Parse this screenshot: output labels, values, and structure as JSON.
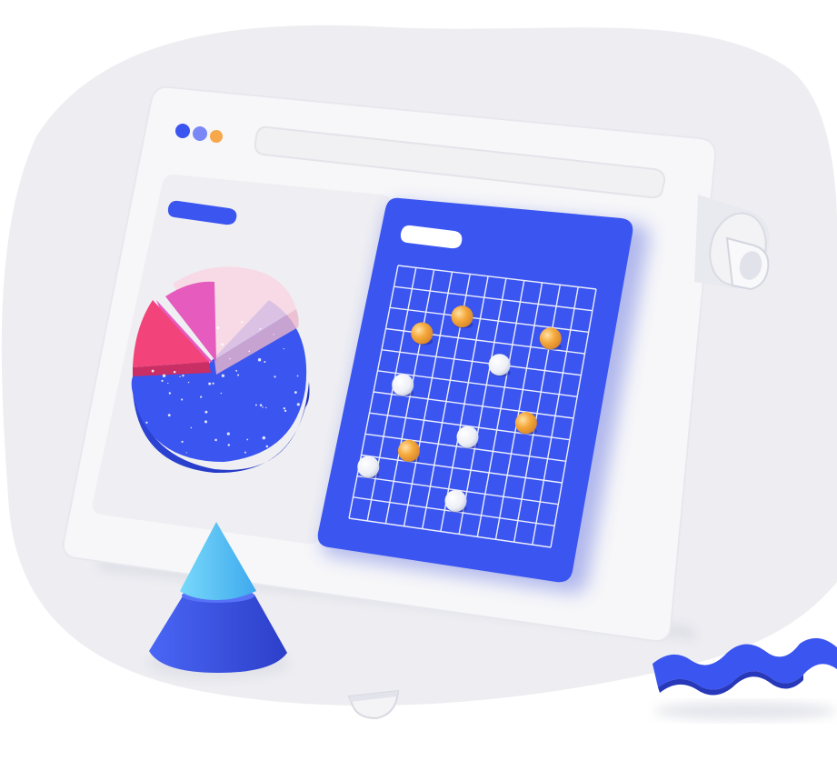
{
  "colors": {
    "background_blob": "#EEEEF2",
    "window": "#F6F6F8",
    "window_shadow": "#E2E3EA",
    "panel": "#EDEDF1",
    "accent_blue": "#3B55F0",
    "accent_blue_dark": "#2E43D4",
    "dot_blue_1": "#3B55F0",
    "dot_blue_2": "#6F7FF5",
    "dot_orange": "#F7A84A",
    "pie_pink": "#F2437A",
    "pie_magenta": "#E55BBE",
    "pie_pale": "#F8D6E2",
    "grid_line": "#FFFFFF",
    "point_orange": "#F5A93C",
    "point_white": "#FFFFFF",
    "cone_top": "#5FC9F3",
    "cone_bottom": "#3B55F0",
    "ribbon": "#3B55F0"
  },
  "icons": {
    "window_controls": [
      "dot-blue-icon",
      "dot-lightblue-icon",
      "dot-orange-icon"
    ],
    "decor": [
      "pie-chart-3d-icon",
      "scatter-grid-icon",
      "cone-icon",
      "ribbon-icon",
      "bowl-icon",
      "pipe-icon"
    ]
  },
  "scatter": {
    "grid": {
      "cols": 11,
      "rows": 12
    },
    "points": [
      {
        "col": 2.0,
        "row": 3.0,
        "kind": "orange"
      },
      {
        "col": 4.0,
        "row": 2.0,
        "kind": "orange"
      },
      {
        "col": 9.0,
        "row": 2.5,
        "kind": "orange"
      },
      {
        "col": 6.5,
        "row": 4.0,
        "kind": "white"
      },
      {
        "col": 1.5,
        "row": 5.5,
        "kind": "white"
      },
      {
        "col": 8.5,
        "row": 6.5,
        "kind": "orange"
      },
      {
        "col": 5.5,
        "row": 7.5,
        "kind": "white"
      },
      {
        "col": 2.5,
        "row": 8.5,
        "kind": "orange"
      },
      {
        "col": 0.5,
        "row": 9.5,
        "kind": "white"
      },
      {
        "col": 5.5,
        "row": 10.5,
        "kind": "white"
      }
    ]
  }
}
